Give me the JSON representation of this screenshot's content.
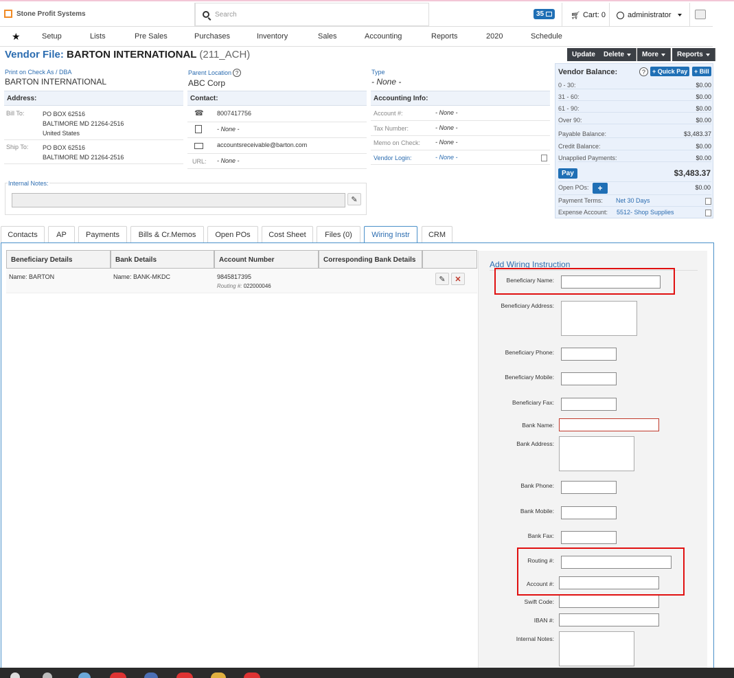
{
  "topbar": {
    "brand": "Stone Profit Systems",
    "search_placeholder": "Search",
    "notifications_count": "35",
    "cart_label": "Cart: 0",
    "user_name": "administrator"
  },
  "nav": {
    "items": [
      "Setup",
      "Lists",
      "Pre Sales",
      "Purchases",
      "Inventory",
      "Sales",
      "Accounting",
      "Reports",
      "2020",
      "Schedule"
    ]
  },
  "vendor": {
    "heading_prefix": "Vendor File:",
    "name": "BARTON INTERNATIONAL",
    "code": "(211_ACH)",
    "actions": {
      "update": "Update",
      "delete": "Delete",
      "more": "More",
      "reports": "Reports"
    }
  },
  "info": {
    "print_on_check_label": "Print on Check As / DBA",
    "print_on_check_value": "BARTON INTERNATIONAL",
    "parent_location_label": "Parent Location",
    "parent_location_value": "ABC Corp",
    "type_label": "Type",
    "type_value": "- None -",
    "address_header": "Address:",
    "bill_to_label": "Bill To:",
    "bill_to_lines": [
      "PO BOX 62516",
      "BALTIMORE MD 21264-2516",
      "United States"
    ],
    "ship_to_label": "Ship To:",
    "ship_to_lines": [
      "PO BOX 62516",
      "BALTIMORE MD 21264-2516"
    ],
    "contact_header": "Contact:",
    "phone": "8007417756",
    "fax": "- None -",
    "email": "accountsreceivable@barton.com",
    "url_label": "URL:",
    "url": "- None -",
    "accounting_header": "Accounting Info:",
    "account_num_label": "Account #:",
    "account_num": "- None -",
    "tax_number_label": "Tax Number:",
    "tax_number": "- None -",
    "memo_label": "Memo on Check:",
    "memo": "- None -",
    "vendor_login_label": "Vendor Login:",
    "vendor_login": "- None -",
    "internal_notes_label": "Internal Notes:"
  },
  "balance": {
    "title": "Vendor Balance:",
    "quick_pay": "+ Quick Pay",
    "bill": "+ Bill",
    "rows": [
      {
        "label": "0 - 30:",
        "value": "$0.00"
      },
      {
        "label": "31 - 60:",
        "value": "$0.00"
      },
      {
        "label": "61 - 90:",
        "value": "$0.00"
      },
      {
        "label": "Over 90:",
        "value": "$0.00"
      },
      {
        "label": "Payable Balance:",
        "value": "$3,483.37"
      },
      {
        "label": "Credit Balance:",
        "value": "$0.00"
      },
      {
        "label": "Unapplied Payments:",
        "value": "$0.00"
      }
    ],
    "pay_label": "Pay",
    "total": "$3,483.37",
    "open_pos_label": "Open POs:",
    "open_pos_value": "$0.00",
    "payment_terms_label": "Payment Terms:",
    "payment_terms_value": "Net 30 Days",
    "expense_account_label": "Expense Account:",
    "expense_account_value": "5512- Shop Supplies"
  },
  "tabs": [
    "Contacts",
    "AP",
    "Payments",
    "Bills & Cr.Memos",
    "Open POs",
    "Cost Sheet",
    "Files (0)",
    "Wiring Instr",
    "CRM"
  ],
  "wiring_table": {
    "columns": [
      "Beneficiary Details",
      "Bank Details",
      "Account Number",
      "Corresponding Bank Details"
    ],
    "rows": [
      {
        "beneficiary": "Name: BARTON",
        "bank": "Name: BANK-MKDC",
        "account": "9845817395",
        "routing_label": "Routing #:",
        "routing": "022000046",
        "corresponding": ""
      }
    ]
  },
  "form": {
    "title": "Add Wiring Instruction",
    "labels": {
      "beneficiary_name": "Beneficiary Name:",
      "beneficiary_address": "Beneficiary Address:",
      "beneficiary_phone": "Beneficiary Phone:",
      "beneficiary_mobile": "Beneficiary Mobile:",
      "beneficiary_fax": "Beneficiary Fax:",
      "bank_name": "Bank Name:",
      "bank_address": "Bank Address:",
      "bank_phone": "Bank Phone:",
      "bank_mobile": "Bank Mobile:",
      "bank_fax": "Bank Fax:",
      "routing": "Routing #:",
      "account": "Account #:",
      "swift": "Swift Code:",
      "iban": "IBAN #:",
      "internal_notes": "Internal Notes:"
    }
  }
}
